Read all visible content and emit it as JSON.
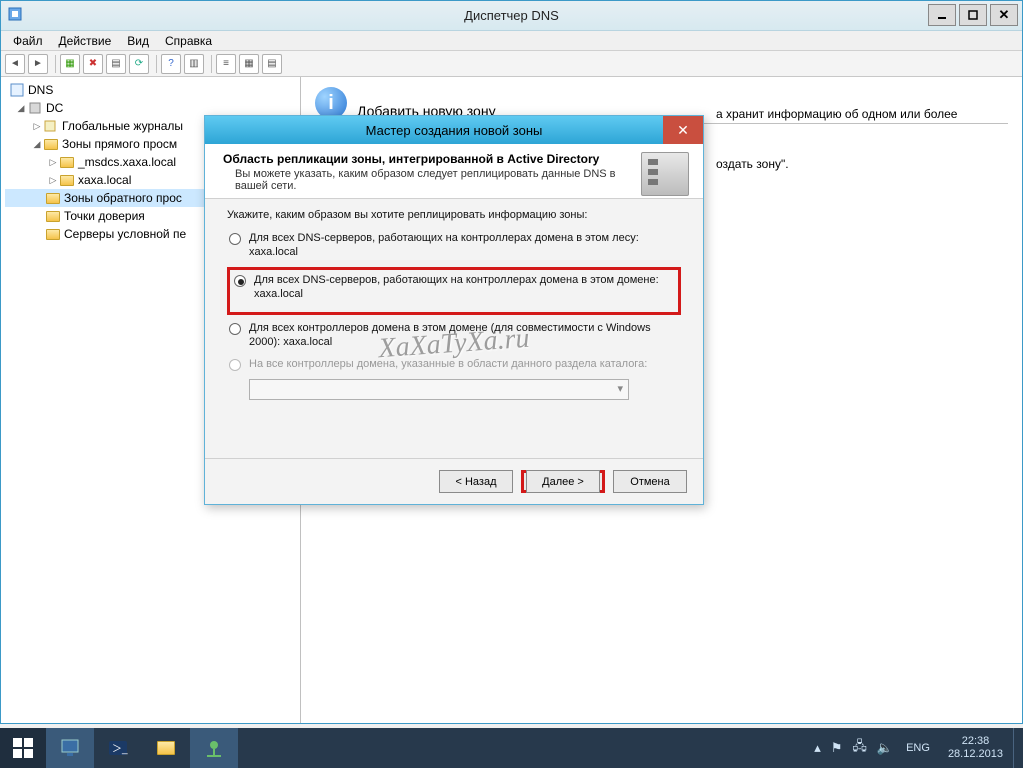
{
  "main_window": {
    "title": "Диспетчер DNS",
    "menu": {
      "file": "Файл",
      "action": "Действие",
      "view": "Вид",
      "help": "Справка"
    }
  },
  "tree": {
    "root": "DNS",
    "dc": "DC",
    "global_logs": "Глобальные журналы",
    "fwd_zones": "Зоны прямого просм",
    "msdcs": "_msdcs.xaxa.local",
    "zone": "xaxa.local",
    "rev_zones": "Зоны обратного прос",
    "trust_points": "Точки доверия",
    "cond_fwd": "Серверы условной пе"
  },
  "content": {
    "heading": "Добавить новую зону",
    "line1_frag": "а хранит информацию об одном или более",
    "line2_frag": "оздать зону\"."
  },
  "wizard": {
    "title": "Мастер создания новой зоны",
    "header_title": "Область репликации зоны, интегрированной в Active Directory",
    "header_sub": "Вы можете указать, каким образом следует реплицировать данные DNS в вашей сети.",
    "prompt": "Укажите, каким образом вы хотите реплицировать информацию зоны:",
    "opt1": "Для всех DNS-серверов, работающих на контроллерах домена в этом лесу:",
    "opt1_dom": "xaxa.local",
    "opt2": "Для всех DNS-серверов, работающих на контроллерах домена в этом домене:",
    "opt2_dom": "xaxa.local",
    "opt3": "Для всех контроллеров домена в этом домене (для совместимости с Windows 2000): xaxa.local",
    "opt4": "На все контроллеры домена, указанные в области данного раздела каталога:",
    "watermark": "XaXaTyXa.ru",
    "btn_back": "< Назад",
    "btn_next": "Далее >",
    "btn_cancel": "Отмена"
  },
  "taskbar": {
    "lang": "ENG",
    "time": "22:38",
    "date": "28.12.2013"
  }
}
